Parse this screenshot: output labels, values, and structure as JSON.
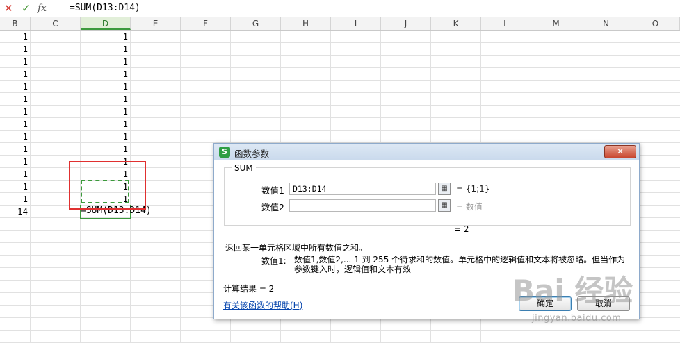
{
  "formula_bar": {
    "cancel_icon": "✕",
    "confirm_icon": "✓",
    "fx_icon": "fx",
    "formula": "=SUM(D13:D14)"
  },
  "columns": [
    "B",
    "C",
    "D",
    "E",
    "F",
    "G",
    "H",
    "I",
    "J",
    "K",
    "L",
    "M",
    "N",
    "O"
  ],
  "active_column": "D",
  "sheet": {
    "col_b_values": [
      "1",
      "1",
      "1",
      "1",
      "1",
      "1",
      "1",
      "1",
      "1",
      "1",
      "1",
      "1",
      "1",
      "1",
      "14"
    ],
    "col_d_values": [
      "1",
      "1",
      "1",
      "1",
      "1",
      "1",
      "1",
      "1",
      "1",
      "1",
      "1",
      "1",
      "1",
      "1"
    ],
    "editing_cell_text": "=SUM(D13:D14)"
  },
  "dialog": {
    "app_icon": "S",
    "title": "函数参数",
    "close_icon": "✕",
    "function_name": "SUM",
    "args": [
      {
        "label": "数值1",
        "value": "D13:D14",
        "ref_icon": "▦",
        "result": "= {1;1}"
      },
      {
        "label": "数值2",
        "value": "",
        "ref_icon": "▦",
        "result": "= 数值"
      }
    ],
    "function_result": "= 2",
    "description": "返回某一单元格区域中所有数值之和。",
    "param_name": "数值1:",
    "param_description": "数值1,数值2,... 1 到 255 个待求和的数值。单元格中的逻辑值和文本将被忽略。但当作为参数键入时，逻辑值和文本有效",
    "calc_result": "计算结果 = 2",
    "help_link": "有关该函数的帮助(H)",
    "ok_label": "确定",
    "cancel_label": "取消"
  },
  "watermark": {
    "logo": "Bai  经验",
    "url": "jingyan.baidu.com"
  },
  "colors": {
    "accent_green": "#3c9a3c",
    "highlight_red": "#e03030",
    "link_blue": "#0645ad"
  }
}
